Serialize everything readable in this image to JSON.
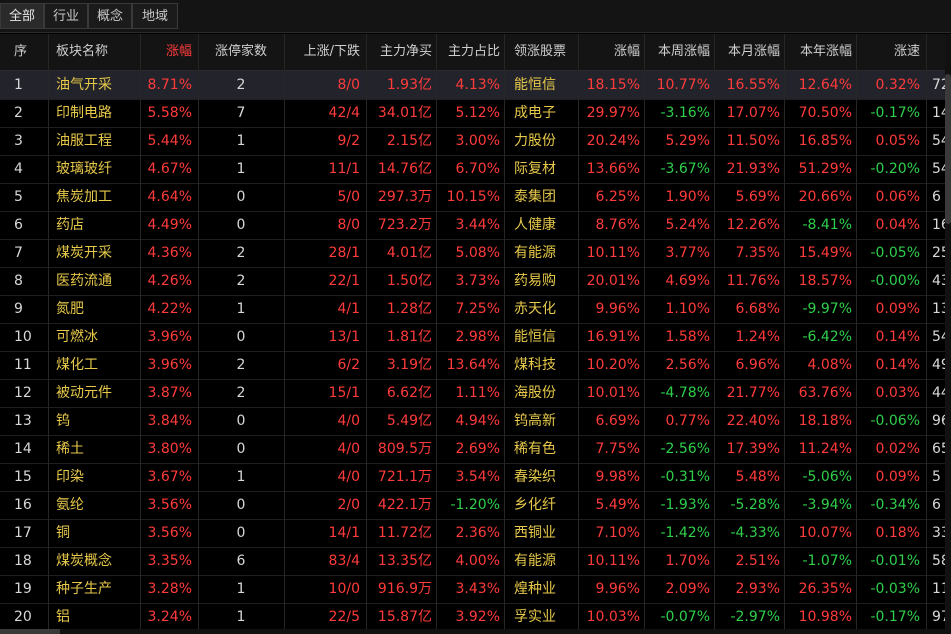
{
  "tabs": [
    {
      "label": "全部",
      "active": true
    },
    {
      "label": "行业",
      "active": false
    },
    {
      "label": "概念",
      "active": false
    },
    {
      "label": "地域",
      "active": false
    }
  ],
  "columns": [
    "序",
    "板块名称",
    "涨幅",
    "涨停家数",
    "上涨/下跌",
    "主力净买",
    "主力占比",
    "领涨股票",
    "涨幅",
    "本周涨幅",
    "本月涨幅",
    "本年涨幅",
    "涨速"
  ],
  "sorted_column_index": 2,
  "selected_row": 0,
  "rows": [
    [
      "1",
      "油气开采",
      "8.71%",
      "2",
      "8/0",
      "1.93亿",
      "4.13%",
      "能恒信",
      "18.15%",
      "10.77%",
      "16.55%",
      "12.64%",
      "0.32%",
      "72"
    ],
    [
      "2",
      "印制电路",
      "5.58%",
      "7",
      "42/4",
      "34.01亿",
      "5.12%",
      "成电子",
      "29.97%",
      "-3.16%",
      "17.07%",
      "70.50%",
      "-0.17%",
      "14"
    ],
    [
      "3",
      "油服工程",
      "5.44%",
      "1",
      "9/2",
      "2.15亿",
      "3.00%",
      "力股份",
      "20.24%",
      "5.29%",
      "11.50%",
      "16.85%",
      "0.05%",
      "54"
    ],
    [
      "4",
      "玻璃玻纤",
      "4.67%",
      "1",
      "11/1",
      "14.76亿",
      "6.70%",
      "际复材",
      "13.66%",
      "-3.67%",
      "21.93%",
      "51.29%",
      "-0.20%",
      "54"
    ],
    [
      "5",
      "焦炭加工",
      "4.64%",
      "0",
      "5/0",
      "297.3万",
      "10.15%",
      "泰集团",
      "6.25%",
      "1.90%",
      "5.69%",
      "20.66%",
      "0.06%",
      "6"
    ],
    [
      "6",
      "药店",
      "4.49%",
      "0",
      "8/0",
      "723.2万",
      "3.44%",
      "人健康",
      "8.76%",
      "5.24%",
      "12.26%",
      "-8.41%",
      "0.04%",
      "16"
    ],
    [
      "7",
      "煤炭开采",
      "4.36%",
      "2",
      "28/1",
      "4.01亿",
      "5.08%",
      "有能源",
      "10.11%",
      "3.77%",
      "7.35%",
      "15.49%",
      "-0.05%",
      "25"
    ],
    [
      "8",
      "医药流通",
      "4.26%",
      "2",
      "22/1",
      "1.50亿",
      "3.73%",
      "药易购",
      "20.01%",
      "4.69%",
      "11.76%",
      "18.57%",
      "-0.00%",
      "43"
    ],
    [
      "9",
      "氮肥",
      "4.22%",
      "1",
      "4/1",
      "1.28亿",
      "7.25%",
      "赤天化",
      "9.96%",
      "1.10%",
      "6.68%",
      "-9.97%",
      "0.09%",
      "13"
    ],
    [
      "10",
      "可燃冰",
      "3.96%",
      "0",
      "13/1",
      "1.81亿",
      "2.98%",
      "能恒信",
      "16.91%",
      "1.58%",
      "1.24%",
      "-6.42%",
      "0.14%",
      "54"
    ],
    [
      "11",
      "煤化工",
      "3.96%",
      "2",
      "6/2",
      "3.19亿",
      "13.64%",
      "煤科技",
      "10.20%",
      "2.56%",
      "6.96%",
      "4.08%",
      "0.14%",
      "49"
    ],
    [
      "12",
      "被动元件",
      "3.87%",
      "2",
      "15/1",
      "6.62亿",
      "1.11%",
      "海股份",
      "10.01%",
      "-4.78%",
      "21.77%",
      "63.76%",
      "0.03%",
      "44"
    ],
    [
      "13",
      "钨",
      "3.84%",
      "0",
      "4/0",
      "5.49亿",
      "4.94%",
      "钨高新",
      "6.69%",
      "0.77%",
      "22.40%",
      "18.18%",
      "-0.06%",
      "96"
    ],
    [
      "14",
      "稀土",
      "3.80%",
      "0",
      "4/0",
      "809.5万",
      "2.69%",
      "稀有色",
      "7.75%",
      "-2.56%",
      "17.39%",
      "11.24%",
      "0.02%",
      "65"
    ],
    [
      "15",
      "印染",
      "3.67%",
      "1",
      "4/0",
      "721.1万",
      "3.54%",
      "春染织",
      "9.98%",
      "-0.31%",
      "5.48%",
      "-5.06%",
      "0.09%",
      "5"
    ],
    [
      "16",
      "氨纶",
      "3.56%",
      "0",
      "2/0",
      "422.1万",
      "-1.20%",
      "乡化纤",
      "5.49%",
      "-1.93%",
      "-5.28%",
      "-3.94%",
      "-0.34%",
      "6"
    ],
    [
      "17",
      "铜",
      "3.56%",
      "0",
      "14/1",
      "11.72亿",
      "2.36%",
      "西铜业",
      "7.10%",
      "-1.42%",
      "-4.33%",
      "10.07%",
      "0.18%",
      "33"
    ],
    [
      "18",
      "煤炭概念",
      "3.35%",
      "6",
      "83/4",
      "13.35亿",
      "4.00%",
      "有能源",
      "10.11%",
      "1.70%",
      "2.51%",
      "-1.07%",
      "-0.01%",
      "58"
    ],
    [
      "19",
      "种子生产",
      "3.28%",
      "1",
      "10/0",
      "916.9万",
      "3.43%",
      "煌种业",
      "9.96%",
      "2.09%",
      "2.93%",
      "26.35%",
      "-0.03%",
      "11"
    ],
    [
      "20",
      "铝",
      "3.24%",
      "1",
      "22/5",
      "15.87亿",
      "3.92%",
      "孚实业",
      "10.03%",
      "-0.07%",
      "-2.97%",
      "10.98%",
      "-0.17%",
      "97"
    ]
  ],
  "colors": {
    "up": "#ff3b3b",
    "down": "#2fcf4b",
    "name": "#e7c94a",
    "neutral": "#d8d8d8"
  }
}
